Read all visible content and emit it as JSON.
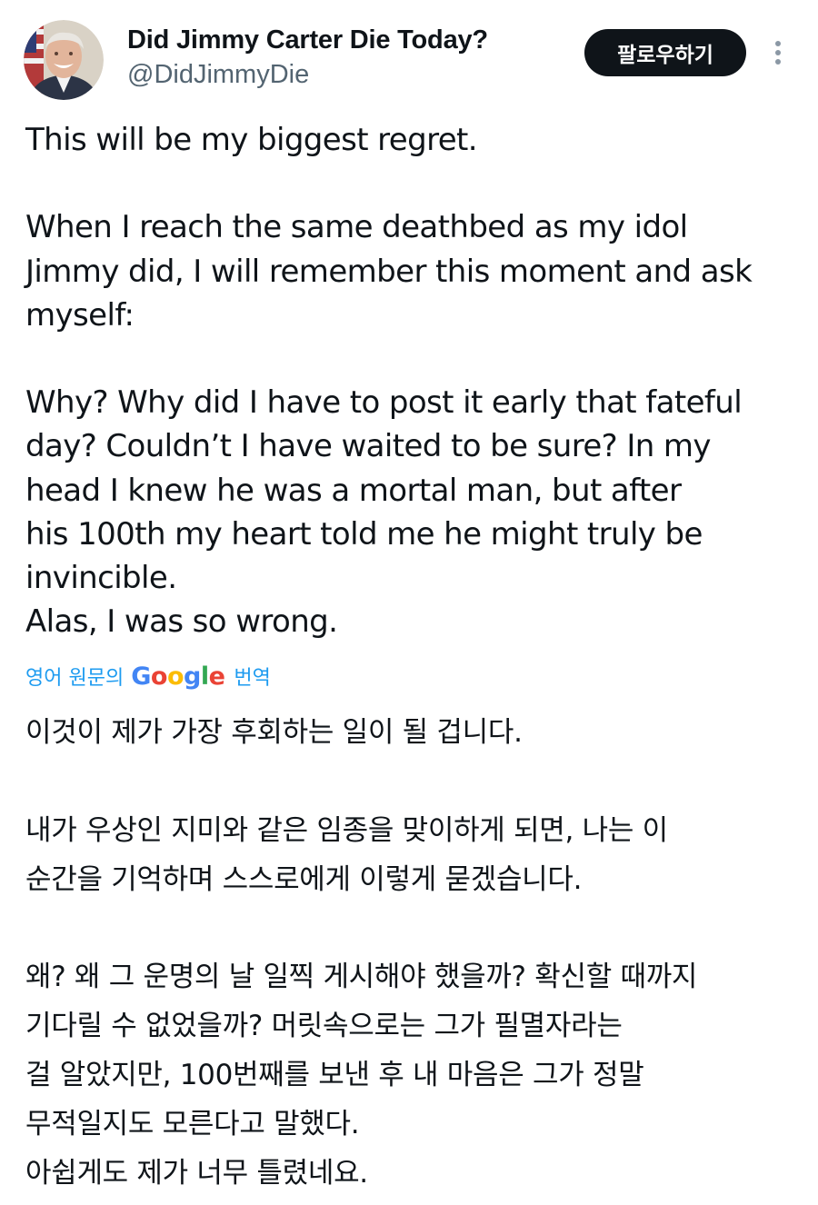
{
  "author": {
    "display_name": "Did Jimmy Carter Die Today?",
    "handle": "@DidJimmyDie",
    "avatar_icon": "profile-photo"
  },
  "actions": {
    "follow_label": "팔로우하기",
    "more_icon": "more-vertical-icon"
  },
  "tweet": {
    "original_lines": [
      "This will be my biggest regret.",
      "",
      "When I reach the same deathbed as my idol",
      "Jimmy did, I will remember this moment and ask",
      "myself:",
      "",
      "Why? Why did I have to post it early that fateful",
      "day? Couldn’t I have waited to be sure? In my",
      "head I knew he was a mortal man, but after",
      "his 100th my heart told me he might truly be",
      "invincible.",
      "Alas, I was so wrong."
    ]
  },
  "translation": {
    "prefix": "영어 원문의",
    "provider": "Google",
    "suffix": "번역",
    "lines": [
      "이것이 제가 가장 후회하는 일이 될 겁니다.",
      "",
      "내가 우상인 지미와 같은 임종을 맞이하게 되면, 나는 이",
      "순간을 기억하며 스스로에게 이렇게 묻겠습니다.",
      "",
      "왜? 왜 그 운명의 날 일찍 게시해야 했을까? 확신할 때까지",
      "기다릴 수 없었을까? 머릿속으로는 그가 필멸자라는",
      "걸 알았지만, 100번째를 보낸 후 내 마음은 그가 정말",
      "무적일지도 모른다고 말했다.",
      "아쉽게도 제가 너무 틀렸네요."
    ]
  },
  "colors": {
    "text": "#0f1419",
    "secondary": "#536471",
    "link": "#1d9bf0",
    "button_bg": "#0f1419"
  }
}
